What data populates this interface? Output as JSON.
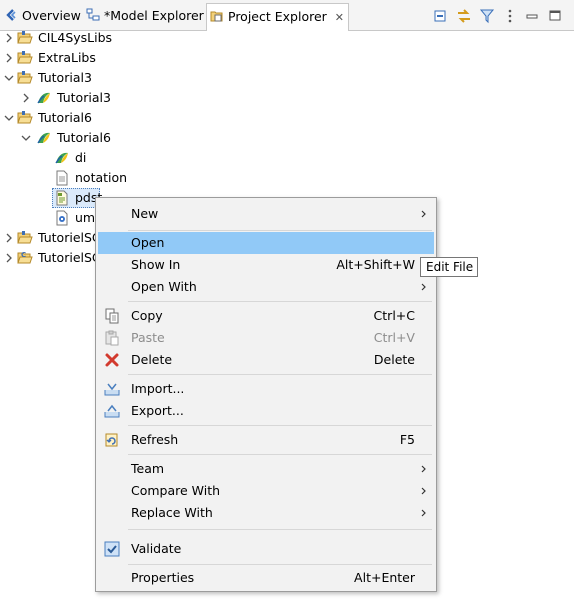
{
  "tabs": [
    {
      "label": "Overview",
      "icon": "model-overview-icon"
    },
    {
      "label": "*Model Explorer",
      "icon": "model-explorer-icon"
    },
    {
      "label": "Project Explorer",
      "icon": "project-explorer-icon",
      "active": true
    }
  ],
  "toolbar": {
    "buttons": [
      "collapse-all-icon",
      "link-with-editor-icon",
      "filter-icon",
      "view-menu-icon",
      "minimize-icon",
      "maximize-icon"
    ]
  },
  "tree": [
    {
      "label": "CIL4SysLibs",
      "level": 0,
      "expanded": false,
      "icon": "folder-open-icon"
    },
    {
      "label": "ExtraLibs",
      "level": 0,
      "expanded": false,
      "icon": "folder-open-icon"
    },
    {
      "label": "Tutorial3",
      "level": 0,
      "expanded": true,
      "icon": "folder-open-icon"
    },
    {
      "label": "Tutorial3",
      "level": 1,
      "expanded": false,
      "icon": "papyrus-model-icon"
    },
    {
      "label": "Tutorial6",
      "level": 0,
      "expanded": true,
      "icon": "folder-open-icon"
    },
    {
      "label": "Tutorial6",
      "level": 1,
      "expanded": true,
      "icon": "papyrus-model-icon"
    },
    {
      "label": "di",
      "level": 2,
      "icon": "papyrus-model-icon"
    },
    {
      "label": "notation",
      "level": 2,
      "icon": "file-icon"
    },
    {
      "label": "pdst",
      "level": 2,
      "icon": "pdst-file-icon",
      "selected": true
    },
    {
      "label": "uml",
      "level": 2,
      "icon": "uml-file-icon"
    },
    {
      "label": "TutorielSC",
      "level": 0,
      "expanded": false,
      "icon": "folder-open-icon"
    },
    {
      "label": "TutorielSC",
      "level": 0,
      "expanded": false,
      "icon": "folder-open-c-icon"
    }
  ],
  "context_menu": {
    "items": [
      {
        "label": "New",
        "submenu": true
      },
      {
        "separator": true
      },
      {
        "label": "Open",
        "highlighted": true
      },
      {
        "label": "Show In",
        "shortcut": "Alt+Shift+W"
      },
      {
        "label": "Open With",
        "submenu": true
      },
      {
        "separator": true
      },
      {
        "label": "Copy",
        "shortcut": "Ctrl+C",
        "icon": "copy-icon"
      },
      {
        "label": "Paste",
        "shortcut": "Ctrl+V",
        "icon": "paste-icon",
        "disabled": true
      },
      {
        "label": "Delete",
        "shortcut": "Delete",
        "icon": "delete-icon"
      },
      {
        "separator": true
      },
      {
        "label": "Import...",
        "icon": "import-icon"
      },
      {
        "label": "Export...",
        "icon": "export-icon"
      },
      {
        "separator": true
      },
      {
        "label": "Refresh",
        "shortcut": "F5",
        "icon": "refresh-icon"
      },
      {
        "separator": true
      },
      {
        "label": "Team",
        "submenu": true
      },
      {
        "label": "Compare With",
        "submenu": true
      },
      {
        "label": "Replace With",
        "submenu": true
      },
      {
        "separator": true
      },
      {
        "label": "Validate",
        "icon": "validate-check-icon"
      },
      {
        "separator": true
      },
      {
        "label": "Properties",
        "shortcut": "Alt+Enter"
      }
    ]
  },
  "tooltip": {
    "text": "Edit File"
  },
  "colors": {
    "highlight": "#91c9f7",
    "selection": "#dbeafb",
    "menu_bg": "#f2f2f2"
  }
}
